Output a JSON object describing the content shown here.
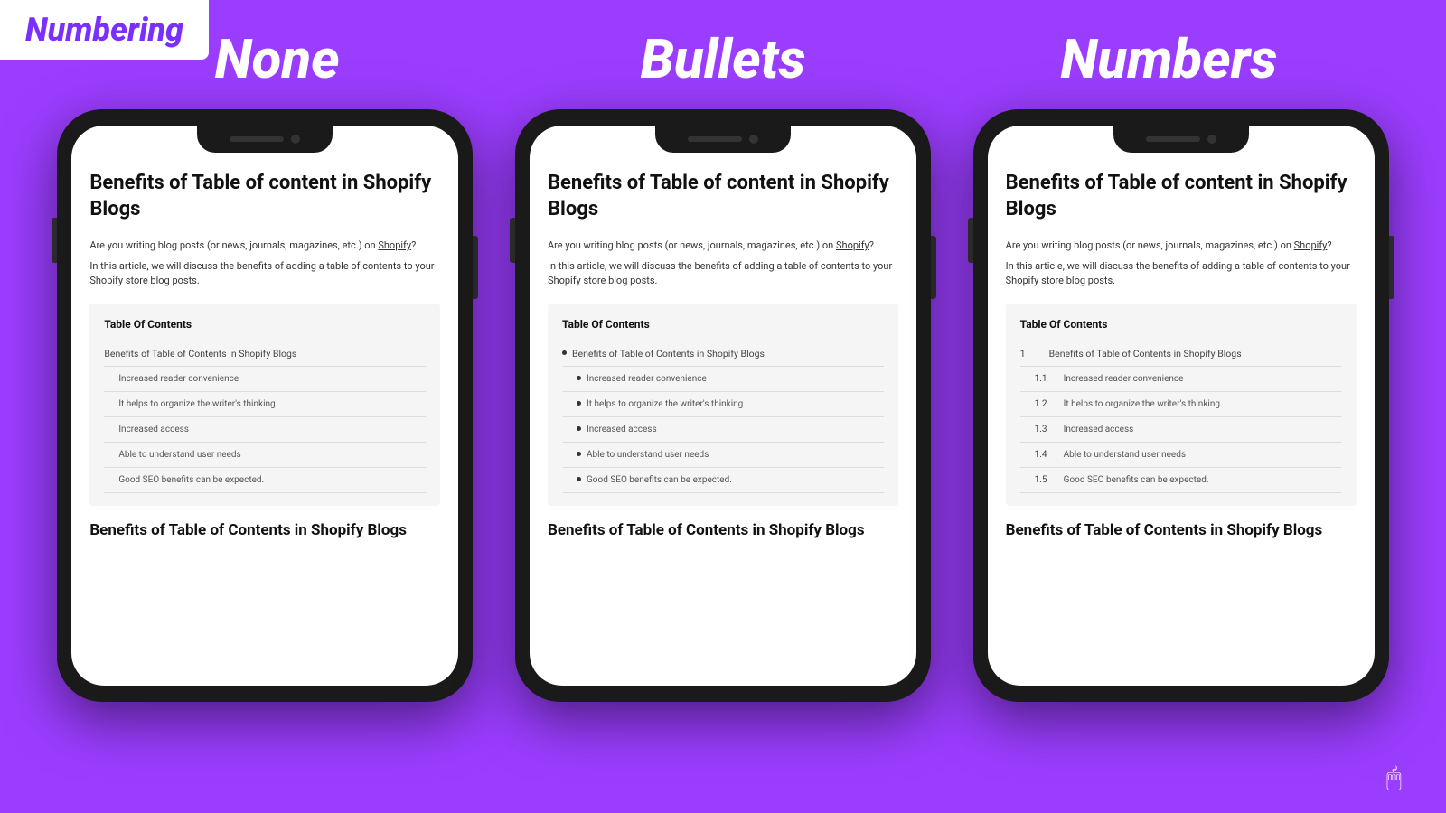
{
  "badge": {
    "title": "Numbering"
  },
  "columns": [
    {
      "id": "none",
      "label": "None"
    },
    {
      "id": "bullets",
      "label": "Bullets"
    },
    {
      "id": "numbers",
      "label": "Numbers"
    }
  ],
  "phone": {
    "article_title": "Benefits of Table of content in Shopify Blogs",
    "intro1": "Are you writing blog posts (or news, journals, magazines, etc.) on ",
    "shopify_link": "Shopify",
    "intro1_end": "?",
    "intro2": "In this article, we will discuss the benefits of adding a table of contents to your Shopify store blog posts.",
    "toc_title": "Table Of Contents",
    "toc_items": {
      "main": "Benefits of Table of Contents in Shopify Blogs",
      "sub": [
        "Increased reader convenience",
        "It helps to organize the writer's thinking.",
        "Increased access",
        "Able to understand user needs",
        "Good SEO benefits can be expected."
      ]
    },
    "footer_heading": "Benefits of Table of Contents in Shopify Blogs"
  }
}
